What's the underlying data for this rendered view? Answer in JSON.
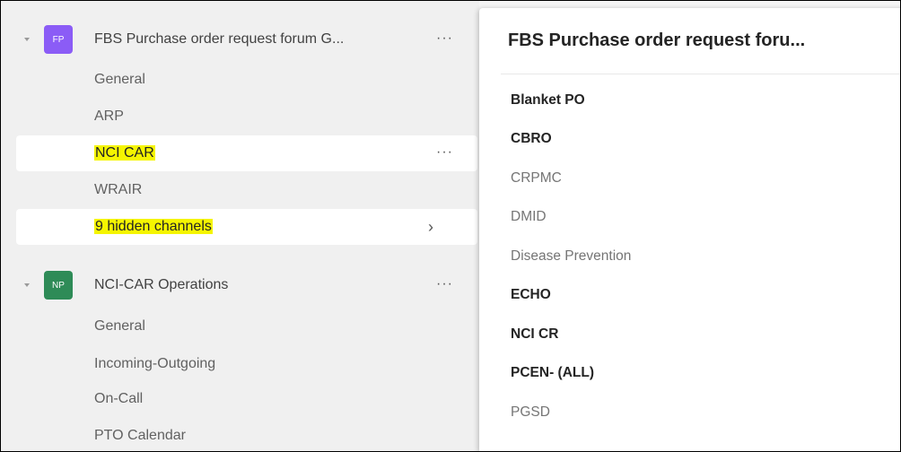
{
  "teams": [
    {
      "initials": "FP",
      "avatar_color": "#8b5cf6",
      "name": "FBS Purchase order request forum G...",
      "more": "···",
      "channels": [
        {
          "label": "General"
        },
        {
          "label": "ARP"
        },
        {
          "label": "NCI CAR",
          "more": "···"
        },
        {
          "label": "WRAIR"
        },
        {
          "label": "9 hidden channels",
          "chevron": "›"
        }
      ]
    },
    {
      "initials": "NP",
      "avatar_color": "#2e8b57",
      "name": "NCI-CAR Operations",
      "more": "···",
      "channels": [
        {
          "label": "General"
        },
        {
          "label": "Incoming-Outgoing"
        },
        {
          "label": "On-Call"
        },
        {
          "label": "PTO Calendar"
        }
      ]
    }
  ],
  "hidden_panel": {
    "title": "FBS Purchase order request foru...",
    "items": [
      {
        "label": "Blanket PO"
      },
      {
        "label": "CBRO"
      },
      {
        "label": "CRPMC"
      },
      {
        "label": "DMID"
      },
      {
        "label": "Disease Prevention"
      },
      {
        "label": "ECHO"
      },
      {
        "label": "NCI CR"
      },
      {
        "label": "PCEN- (ALL)"
      },
      {
        "label": "PGSD"
      }
    ]
  }
}
